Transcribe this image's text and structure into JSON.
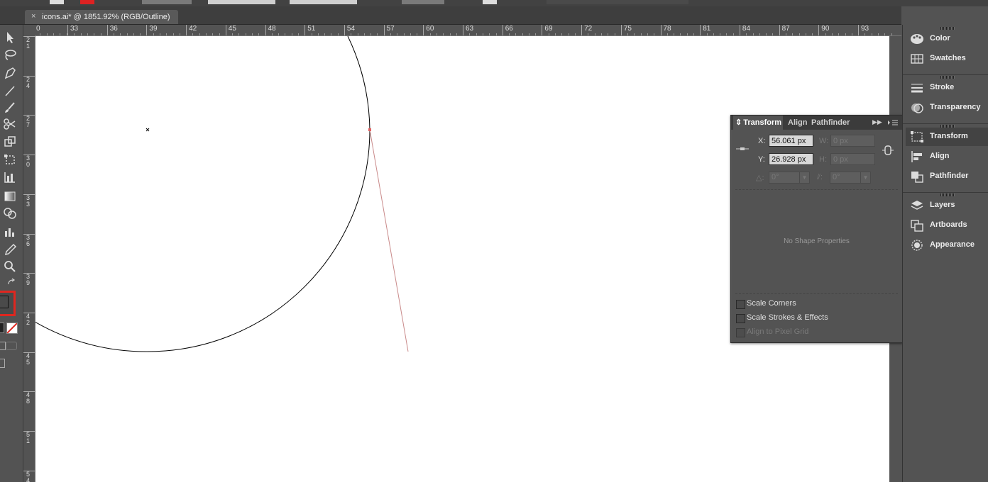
{
  "document": {
    "tab_title": "icons.ai* @ 1851.92% (RGB/Outline)",
    "close_glyph": "×"
  },
  "colors": {
    "ui_bg": "#535353",
    "canvas": "#ffffff",
    "fill_swatch": "#e0261f",
    "path_selected": "#e06060",
    "direction_line": "#c98a8a"
  },
  "ruler": {
    "horizontal": [
      "0",
      "33",
      "36",
      "39",
      "42",
      "45",
      "48",
      "51",
      "54",
      "57",
      "60",
      "63",
      "66",
      "69",
      "72",
      "75",
      "78",
      "81",
      "84",
      "87",
      "90",
      "93"
    ],
    "vertical": [
      [
        "2",
        "1"
      ],
      [
        "2",
        "4"
      ],
      [
        "2",
        "7"
      ],
      [
        "3",
        "0"
      ],
      [
        "3",
        "3"
      ],
      [
        "3",
        "6"
      ],
      [
        "3",
        "9"
      ],
      [
        "4",
        "2"
      ],
      [
        "4",
        "5"
      ],
      [
        "4",
        "8"
      ],
      [
        "5",
        "1"
      ],
      [
        "5",
        "4"
      ]
    ]
  },
  "tools": [
    "selection-tool",
    "lasso-tool",
    "pen-tool",
    "line-tool",
    "paintbrush-tool",
    "scissors-tool",
    "scale-tool",
    "free-transform-tool",
    "graph-grid-tool",
    "gradient-tool",
    "shape-builder-tool",
    "column-graph-tool",
    "eyedropper-tool",
    "zoom-tool"
  ],
  "transform_panel": {
    "tabs": [
      "Transform",
      "Align",
      "Pathfinder"
    ],
    "x_label": "X:",
    "x_value": "56.061 px",
    "y_label": "Y:",
    "y_value": "26.928 px",
    "w_label": "W:",
    "w_value": "0 px",
    "h_label": "H:",
    "h_value": "0 px",
    "rotate_value": "0°",
    "shear_value": "0°",
    "no_shape": "No Shape Properties",
    "scale_corners": "Scale Corners",
    "scale_strokes": "Scale Strokes & Effects",
    "align_pixel": "Align to Pixel Grid"
  },
  "dock": {
    "groups": [
      [
        {
          "label": "Color",
          "icon": "palette-icon"
        },
        {
          "label": "Swatches",
          "icon": "swatches-grid-icon"
        }
      ],
      [
        {
          "label": "Stroke",
          "icon": "stroke-lines-icon"
        },
        {
          "label": "Transparency",
          "icon": "transparency-circles-icon"
        }
      ],
      [
        {
          "label": "Transform",
          "icon": "transform-box-icon"
        },
        {
          "label": "Align",
          "icon": "align-bars-icon"
        },
        {
          "label": "Pathfinder",
          "icon": "pathfinder-squares-icon"
        }
      ],
      [
        {
          "label": "Layers",
          "icon": "layers-stack-icon"
        },
        {
          "label": "Artboards",
          "icon": "artboards-icon"
        },
        {
          "label": "Appearance",
          "icon": "appearance-circle-icon"
        }
      ]
    ],
    "active": "Transform"
  }
}
